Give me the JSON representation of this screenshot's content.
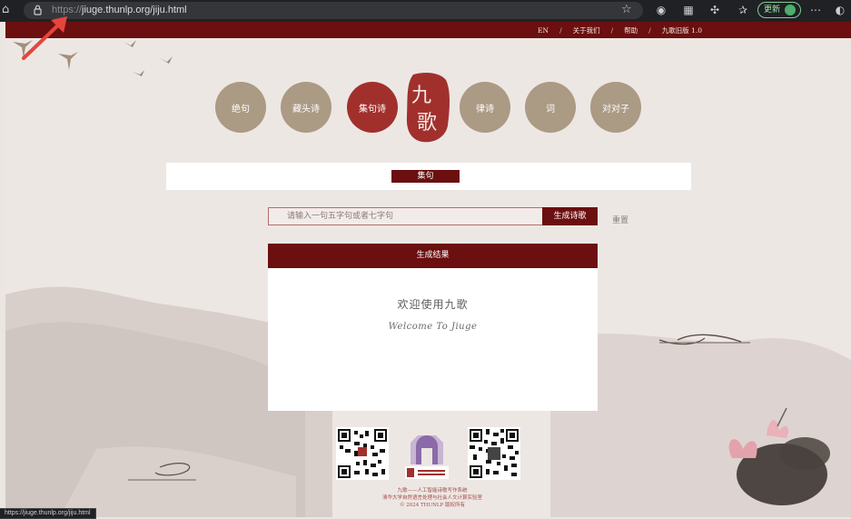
{
  "browser": {
    "url_scheme": "https://",
    "url_rest": "jiuge.thunlp.org/jiju.html",
    "update_label": "更新",
    "status_url": "https://jiuge.thunlp.org/jiju.html"
  },
  "topnav": {
    "items": [
      "EN",
      "关于我们",
      "帮助",
      "九歌旧版 1.0"
    ],
    "separator": "/"
  },
  "nav": {
    "items": [
      "绝句",
      "藏头诗",
      "集句诗",
      "律诗",
      "词",
      "对对子"
    ],
    "active": "集句诗"
  },
  "seal": {
    "char1": "九",
    "char2": "歌"
  },
  "section": {
    "title": "集句"
  },
  "input": {
    "placeholder": "请输入一句五字句或者七字句",
    "value": "",
    "generate_label": "生成诗歌",
    "reset_label": "重置"
  },
  "result": {
    "header": "生成结果",
    "welcome_zh": "欢迎使用九歌",
    "welcome_en": "Welcome To Jiuge"
  },
  "footer": {
    "line1": "九歌——人工智能诗歌写作系统",
    "line2": "清华大学自然语言处理与社会人文计算实验室",
    "line3": "© 2024 THUNLP 版权所有"
  },
  "colors": {
    "brand": "#6b0f10",
    "nav_circle": "#ab9a84",
    "nav_active": "#a1302d",
    "background": "#ede7e4"
  }
}
